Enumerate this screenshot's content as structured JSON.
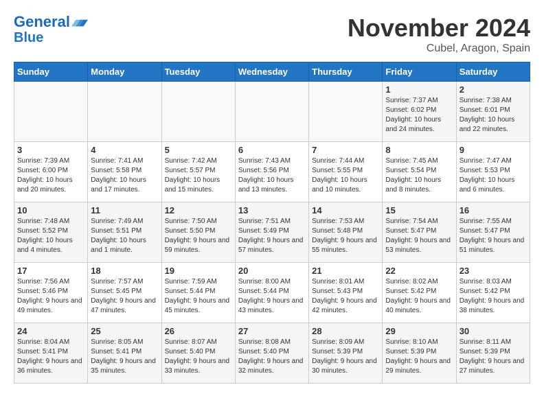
{
  "header": {
    "logo_line1": "General",
    "logo_line2": "Blue",
    "month": "November 2024",
    "location": "Cubel, Aragon, Spain"
  },
  "weekdays": [
    "Sunday",
    "Monday",
    "Tuesday",
    "Wednesday",
    "Thursday",
    "Friday",
    "Saturday"
  ],
  "weeks": [
    [
      {
        "day": "",
        "info": ""
      },
      {
        "day": "",
        "info": ""
      },
      {
        "day": "",
        "info": ""
      },
      {
        "day": "",
        "info": ""
      },
      {
        "day": "",
        "info": ""
      },
      {
        "day": "1",
        "info": "Sunrise: 7:37 AM\nSunset: 6:02 PM\nDaylight: 10 hours and 24 minutes."
      },
      {
        "day": "2",
        "info": "Sunrise: 7:38 AM\nSunset: 6:01 PM\nDaylight: 10 hours and 22 minutes."
      }
    ],
    [
      {
        "day": "3",
        "info": "Sunrise: 7:39 AM\nSunset: 6:00 PM\nDaylight: 10 hours and 20 minutes."
      },
      {
        "day": "4",
        "info": "Sunrise: 7:41 AM\nSunset: 5:58 PM\nDaylight: 10 hours and 17 minutes."
      },
      {
        "day": "5",
        "info": "Sunrise: 7:42 AM\nSunset: 5:57 PM\nDaylight: 10 hours and 15 minutes."
      },
      {
        "day": "6",
        "info": "Sunrise: 7:43 AM\nSunset: 5:56 PM\nDaylight: 10 hours and 13 minutes."
      },
      {
        "day": "7",
        "info": "Sunrise: 7:44 AM\nSunset: 5:55 PM\nDaylight: 10 hours and 10 minutes."
      },
      {
        "day": "8",
        "info": "Sunrise: 7:45 AM\nSunset: 5:54 PM\nDaylight: 10 hours and 8 minutes."
      },
      {
        "day": "9",
        "info": "Sunrise: 7:47 AM\nSunset: 5:53 PM\nDaylight: 10 hours and 6 minutes."
      }
    ],
    [
      {
        "day": "10",
        "info": "Sunrise: 7:48 AM\nSunset: 5:52 PM\nDaylight: 10 hours and 4 minutes."
      },
      {
        "day": "11",
        "info": "Sunrise: 7:49 AM\nSunset: 5:51 PM\nDaylight: 10 hours and 1 minute."
      },
      {
        "day": "12",
        "info": "Sunrise: 7:50 AM\nSunset: 5:50 PM\nDaylight: 9 hours and 59 minutes."
      },
      {
        "day": "13",
        "info": "Sunrise: 7:51 AM\nSunset: 5:49 PM\nDaylight: 9 hours and 57 minutes."
      },
      {
        "day": "14",
        "info": "Sunrise: 7:53 AM\nSunset: 5:48 PM\nDaylight: 9 hours and 55 minutes."
      },
      {
        "day": "15",
        "info": "Sunrise: 7:54 AM\nSunset: 5:47 PM\nDaylight: 9 hours and 53 minutes."
      },
      {
        "day": "16",
        "info": "Sunrise: 7:55 AM\nSunset: 5:47 PM\nDaylight: 9 hours and 51 minutes."
      }
    ],
    [
      {
        "day": "17",
        "info": "Sunrise: 7:56 AM\nSunset: 5:46 PM\nDaylight: 9 hours and 49 minutes."
      },
      {
        "day": "18",
        "info": "Sunrise: 7:57 AM\nSunset: 5:45 PM\nDaylight: 9 hours and 47 minutes."
      },
      {
        "day": "19",
        "info": "Sunrise: 7:59 AM\nSunset: 5:44 PM\nDaylight: 9 hours and 45 minutes."
      },
      {
        "day": "20",
        "info": "Sunrise: 8:00 AM\nSunset: 5:44 PM\nDaylight: 9 hours and 43 minutes."
      },
      {
        "day": "21",
        "info": "Sunrise: 8:01 AM\nSunset: 5:43 PM\nDaylight: 9 hours and 42 minutes."
      },
      {
        "day": "22",
        "info": "Sunrise: 8:02 AM\nSunset: 5:42 PM\nDaylight: 9 hours and 40 minutes."
      },
      {
        "day": "23",
        "info": "Sunrise: 8:03 AM\nSunset: 5:42 PM\nDaylight: 9 hours and 38 minutes."
      }
    ],
    [
      {
        "day": "24",
        "info": "Sunrise: 8:04 AM\nSunset: 5:41 PM\nDaylight: 9 hours and 36 minutes."
      },
      {
        "day": "25",
        "info": "Sunrise: 8:05 AM\nSunset: 5:41 PM\nDaylight: 9 hours and 35 minutes."
      },
      {
        "day": "26",
        "info": "Sunrise: 8:07 AM\nSunset: 5:40 PM\nDaylight: 9 hours and 33 minutes."
      },
      {
        "day": "27",
        "info": "Sunrise: 8:08 AM\nSunset: 5:40 PM\nDaylight: 9 hours and 32 minutes."
      },
      {
        "day": "28",
        "info": "Sunrise: 8:09 AM\nSunset: 5:39 PM\nDaylight: 9 hours and 30 minutes."
      },
      {
        "day": "29",
        "info": "Sunrise: 8:10 AM\nSunset: 5:39 PM\nDaylight: 9 hours and 29 minutes."
      },
      {
        "day": "30",
        "info": "Sunrise: 8:11 AM\nSunset: 5:39 PM\nDaylight: 9 hours and 27 minutes."
      }
    ]
  ]
}
